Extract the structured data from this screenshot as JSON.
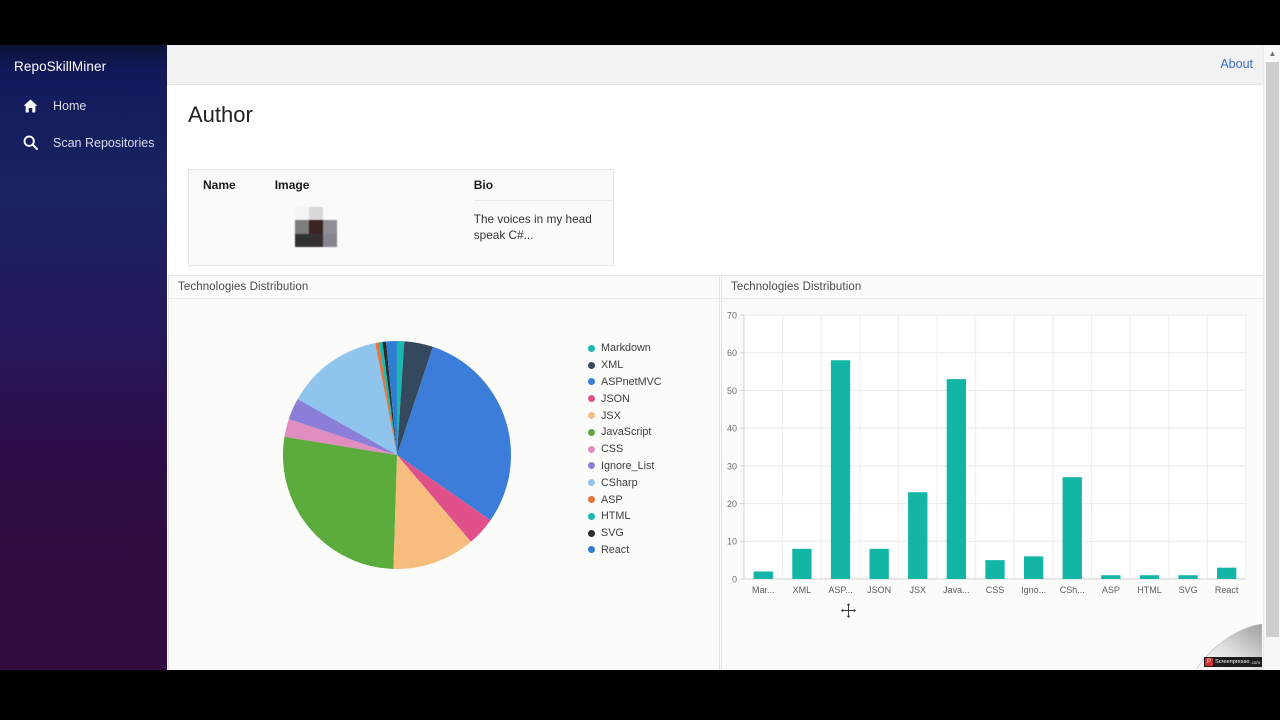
{
  "app": {
    "brand": "RepoSkillMiner"
  },
  "sidebar": {
    "items": [
      {
        "label": "Home",
        "icon": "home-icon"
      },
      {
        "label": "Scan Repositories",
        "icon": "search-icon"
      }
    ]
  },
  "topbar": {
    "about_label": "About"
  },
  "page": {
    "title": "Author"
  },
  "author_table": {
    "headers": [
      "Name",
      "Image",
      "Bio"
    ],
    "rows": [
      {
        "name": "",
        "image": "author-avatar",
        "bio": "The voices in my head speak C#..."
      }
    ]
  },
  "panels": {
    "pie_title": "Technologies Distribution",
    "bar_title": "Technologies Distribution"
  },
  "scrollbar": {
    "up_arrow": "▲"
  },
  "watermark": {
    "badge": "P",
    "name": "Screenpresso",
    "suffix": ".com"
  },
  "cursor": {
    "type": "move-cursor"
  },
  "chart_data": [
    {
      "id": "pie",
      "type": "pie",
      "title": "Technologies Distribution",
      "legend_position": "right",
      "labels": [
        "Markdown",
        "XML",
        "ASPnetMVC",
        "JSON",
        "JSX",
        "JavaScript",
        "CSS",
        "Ignore_List",
        "CSharp",
        "ASP",
        "HTML",
        "SVG",
        "React"
      ],
      "values": [
        2,
        8,
        58,
        8,
        23,
        53,
        5,
        6,
        27,
        1,
        1,
        1,
        3
      ],
      "colors": [
        "#1 abc9c",
        "#34495e",
        "#3b7dd8",
        "#e0518c",
        "#f7bd7f",
        "#5cab3d",
        "#e08ec0",
        "#8a7ed8",
        "#8fc4ec",
        "#e8743b",
        "#17b9b0",
        "#2b2b2b",
        "#2f7fd1"
      ],
      "slice_colors": [
        "#17b9b0",
        "#34495e",
        "#3b7dd8",
        "#e0518c",
        "#f7bd7f",
        "#5cab3d",
        "#e08ec0",
        "#8a7ed8",
        "#8fc4ec",
        "#e8743b",
        "#17b9b0",
        "#2b2b2b",
        "#2f7fd1"
      ]
    },
    {
      "id": "bar",
      "type": "bar",
      "title": "Technologies Distribution",
      "categories": [
        "Markdown",
        "XML",
        "ASPnetMVC",
        "JSON",
        "JSX",
        "JavaScript",
        "CSS",
        "Ignore_List",
        "CSharp",
        "ASP",
        "HTML",
        "SVG",
        "React"
      ],
      "tick_labels": [
        "Mar...",
        "XML",
        "ASP...",
        "JSON",
        "JSX",
        "Java...",
        "CSS",
        "Igno...",
        "CSh...",
        "ASP",
        "HTML",
        "SVG",
        "React"
      ],
      "values": [
        2,
        8,
        58,
        8,
        23,
        53,
        5,
        6,
        27,
        1,
        1,
        1,
        3
      ],
      "ylim": [
        0,
        70
      ],
      "yticks": [
        0,
        10,
        20,
        30,
        40,
        50,
        60,
        70
      ],
      "bar_color": "#13b5a6",
      "grid": true,
      "xlabel": "",
      "ylabel": ""
    }
  ]
}
